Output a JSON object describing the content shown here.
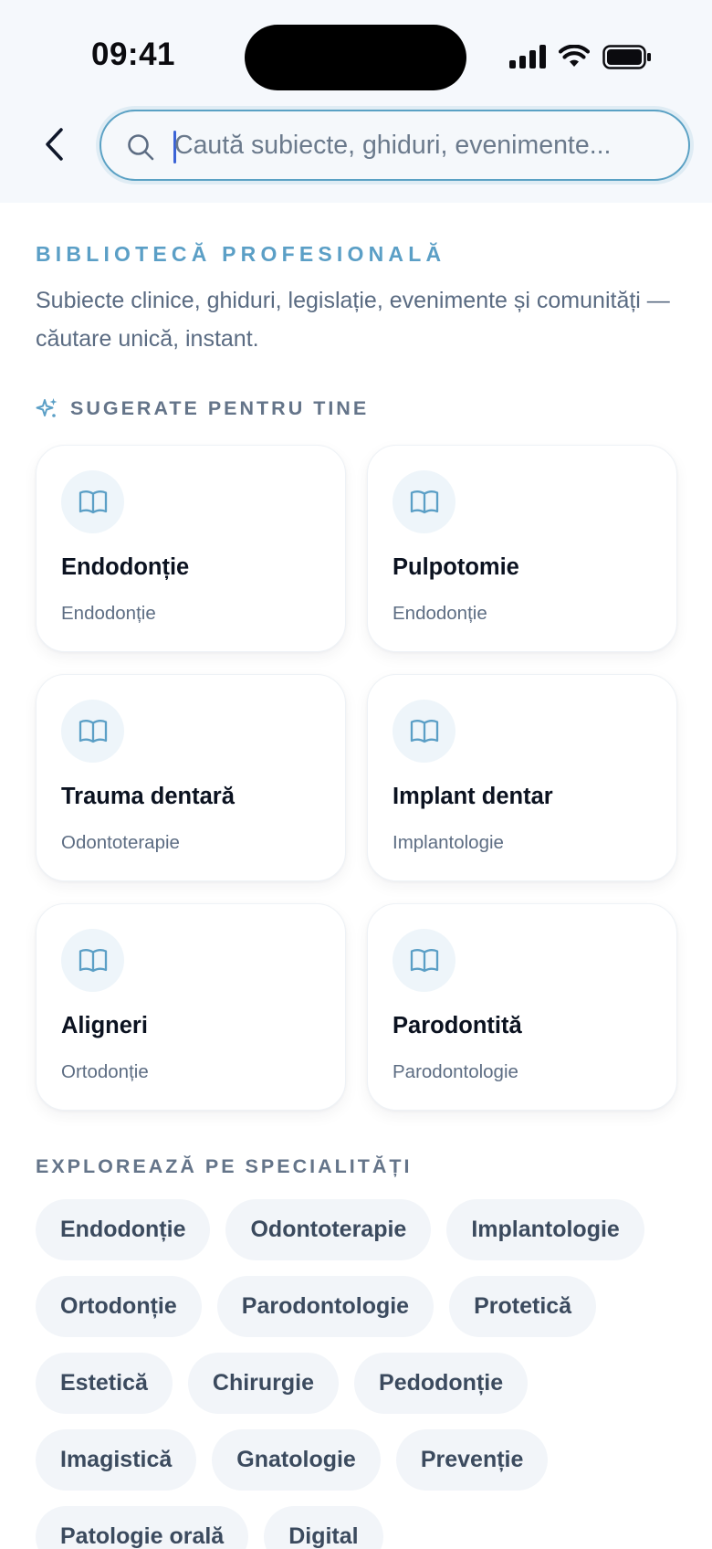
{
  "status_bar": {
    "time": "09:41"
  },
  "search": {
    "placeholder": "Caută subiecte, ghiduri, evenimente..."
  },
  "header": {
    "eyebrow": "BIBLIOTECĂ PROFESIONALĂ",
    "intro": "Subiecte clinice, ghiduri, legislație, evenimente și comunități — căutare unică, instant."
  },
  "suggested": {
    "label": "SUGERATE PENTRU TINE",
    "items": [
      {
        "title": "Endodonție",
        "category": "Endodonție"
      },
      {
        "title": "Pulpotomie",
        "category": "Endodonție"
      },
      {
        "title": "Trauma dentară",
        "category": "Odontoterapie"
      },
      {
        "title": "Implant dentar",
        "category": "Implantologie"
      },
      {
        "title": "Aligneri",
        "category": "Ortodonție"
      },
      {
        "title": "Parodontită",
        "category": "Parodontologie"
      }
    ]
  },
  "specialties": {
    "label": "EXPLOREAZĂ PE SPECIALITĂȚI",
    "items": [
      "Endodonție",
      "Odontoterapie",
      "Implantologie",
      "Ortodonție",
      "Parodontologie",
      "Protetică",
      "Estetică",
      "Chirurgie",
      "Pedodonție",
      "Imagistică",
      "Gnatologie",
      "Prevenție",
      "Patologie orală",
      "Digital"
    ]
  },
  "colors": {
    "accent": "#5b9fc6",
    "caret": "#3b63d6",
    "text_muted": "#647489"
  },
  "icons": {
    "back": "chevron-left-icon",
    "search": "search-icon",
    "card": "book-open-icon",
    "section": "sparkles-icon"
  }
}
